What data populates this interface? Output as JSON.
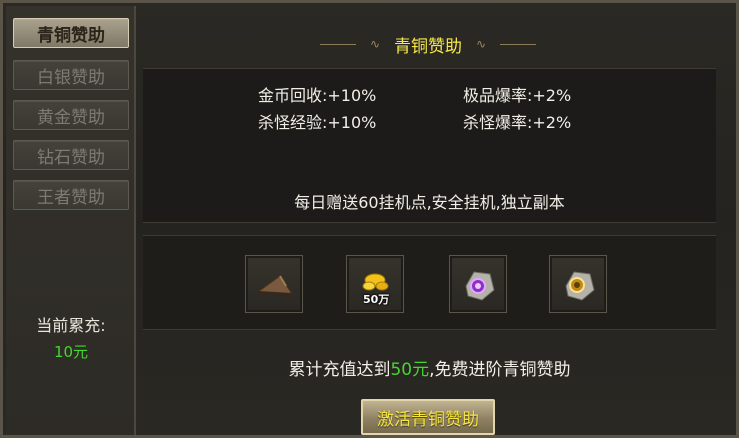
{
  "sidebar": {
    "items": [
      {
        "label": "青铜赞助",
        "active": true
      },
      {
        "label": "白银赞助",
        "active": false
      },
      {
        "label": "黄金赞助",
        "active": false
      },
      {
        "label": "钻石赞助",
        "active": false
      },
      {
        "label": "王者赞助",
        "active": false
      }
    ],
    "recharge_label": "当前累充:",
    "recharge_value": "10元"
  },
  "main": {
    "title": "青铜赞助",
    "bonuses": [
      {
        "text": "金币回收:+10%"
      },
      {
        "text": "极品爆率:+2%"
      },
      {
        "text": "杀怪经验:+10%"
      },
      {
        "text": "杀怪爆率:+2%"
      }
    ],
    "daily_text": "每日赠送60挂机点,安全挂机,独立副本",
    "rewards": [
      {
        "icon": "hat-icon"
      },
      {
        "icon": "gold-coins-icon",
        "amount": "50万"
      },
      {
        "icon": "purple-gem-ore-icon"
      },
      {
        "icon": "gold-gem-ore-icon"
      }
    ],
    "upgrade": {
      "prefix": "累计充值达到",
      "amount": "50元",
      "suffix": ",免费进阶青铜赞助"
    },
    "activate_button": "激活青铜赞助"
  },
  "colors": {
    "accent_yellow": "#f7e84a",
    "green": "#45d630",
    "text": "#f1eee6"
  }
}
